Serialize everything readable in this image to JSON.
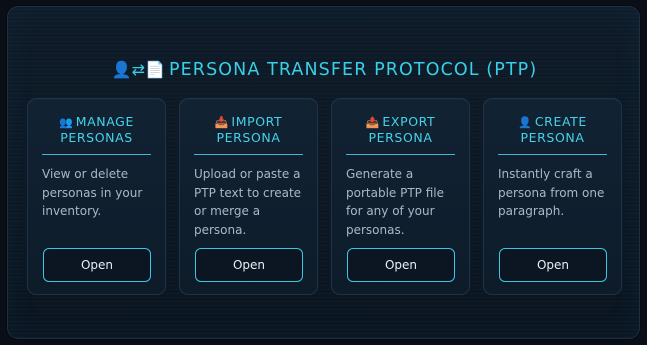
{
  "header": {
    "icon": "👤⇄📄",
    "icon_name": "persona-transfer-icon",
    "title": "PERSONA TRANSFER PROTOCOL (PTP)"
  },
  "cards": [
    {
      "icon": "👥",
      "icon_name": "people-icon",
      "title_line1": "MANAGE",
      "title_line2": "PERSONAS",
      "description": "View or delete personas in your inventory.",
      "button_label": "Open"
    },
    {
      "icon": "📥",
      "icon_name": "inbox-tray-icon",
      "title_line1": "IMPORT",
      "title_line2": "PERSONA",
      "description": "Upload or paste a PTP text to create or merge a persona.",
      "button_label": "Open"
    },
    {
      "icon": "📤",
      "icon_name": "outbox-tray-icon",
      "title_line1": "EXPORT",
      "title_line2": "PERSONA",
      "description": "Generate a portable PTP file for any of your personas.",
      "button_label": "Open"
    },
    {
      "icon": "👤",
      "icon_name": "person-icon",
      "title_line1": "CREATE",
      "title_line2": "PERSONA",
      "description": "Instantly craft a persona from one paragraph.",
      "button_label": "Open"
    }
  ],
  "colors": {
    "accent": "#38cfe8",
    "background": "#0a0f17",
    "panel": "#0d1824",
    "card": "#112233"
  }
}
